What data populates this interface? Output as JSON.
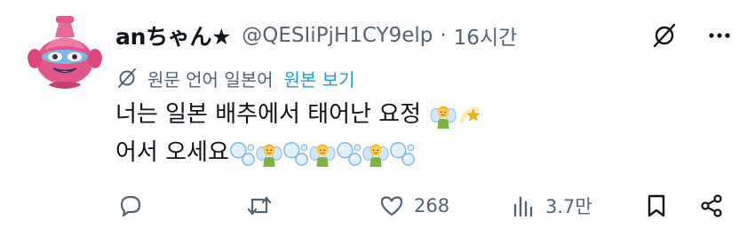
{
  "tweet": {
    "display_name": "anちゃん★",
    "handle": "@QESIiPjH1CY9elp",
    "separator": "·",
    "time": "16시간"
  },
  "translation": {
    "label": "원문 언어 일본어",
    "show_original": "원본 보기"
  },
  "body": {
    "line1": "너는 일본 배추에서 태어난 요정",
    "line2": "어서 오세요"
  },
  "actions": {
    "reply_count": "",
    "retweet_count": "",
    "like_count": "268",
    "views_count": "3.7만"
  },
  "icons": {
    "grok": "grok-slash-icon",
    "more": "more-dots-icon",
    "translate": "translate-icon",
    "fairy": "fairy-emoji",
    "dizzy": "dizzy-emoji",
    "bubbles": "bubbles-emoji",
    "reply": "reply-icon",
    "retweet": "retweet-icon",
    "like": "heart-icon",
    "views": "views-icon",
    "bookmark": "bookmark-icon",
    "share": "share-icon"
  },
  "colors": {
    "text": "#0f1419",
    "secondary": "#536471",
    "link": "#1d9bf0"
  }
}
